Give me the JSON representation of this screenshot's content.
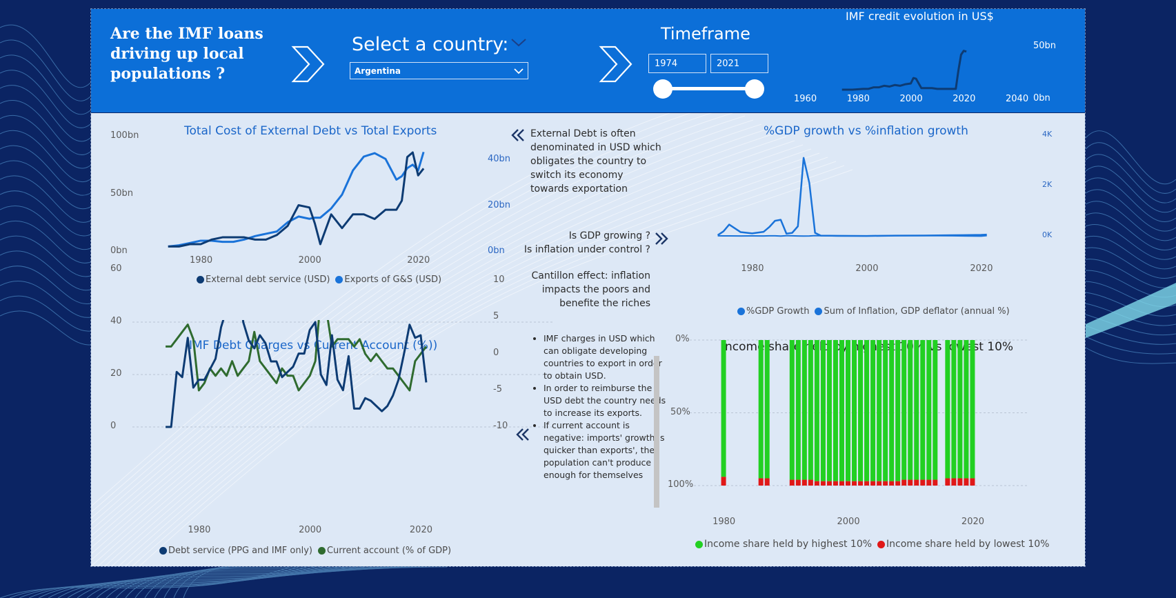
{
  "header": {
    "question": "Are the IMF loans driving up local populations ?",
    "select_label": "Select a country:",
    "country_value": "Argentina",
    "timeframe_label": "Timeframe",
    "timeframe_start": "1974",
    "timeframe_end": "2021"
  },
  "mini_chart": {
    "title": "IMF credit evolution in US$",
    "y_ticks": [
      "50bn",
      "0bn"
    ],
    "x_ticks": [
      "1960",
      "1980",
      "2000",
      "2020",
      "2040"
    ],
    "chart_data": {
      "type": "line",
      "title": "IMF credit evolution in US$",
      "x": [
        1974,
        1978,
        1982,
        1984,
        1986,
        1988,
        1990,
        1992,
        1994,
        1996,
        1998,
        2000,
        2001,
        2002,
        2004,
        2006,
        2008,
        2010,
        2012,
        2014,
        2016,
        2017,
        2018,
        2019,
        2020,
        2021
      ],
      "values": [
        0,
        0,
        1,
        1,
        3,
        3,
        5,
        4,
        6,
        5,
        7,
        8,
        15,
        14,
        2,
        2,
        2,
        1,
        1,
        1,
        1,
        1,
        25,
        45,
        50,
        49
      ],
      "xlim": [
        1960,
        2040
      ],
      "ylim": [
        0,
        55
      ],
      "ylabel": "",
      "color": "#0d3b73"
    }
  },
  "chart1": {
    "title": "Total Cost of External Debt vs Total Exports",
    "left_ticks": [
      "100bn",
      "50bn",
      "0bn"
    ],
    "right_ticks": [
      "40bn",
      "20bn",
      "0bn"
    ],
    "x_ticks": [
      "1980",
      "2000",
      "2020"
    ],
    "legend": [
      "External debt service (USD)",
      "Exports of G&S (USD)"
    ],
    "colors": [
      "#0d3b73",
      "#1a73d9"
    ],
    "chart_data": {
      "type": "line",
      "title": "Total Cost of External Debt vs Total Exports",
      "x": [
        1974,
        1976,
        1978,
        1980,
        1982,
        1984,
        1986,
        1988,
        1990,
        1992,
        1994,
        1996,
        1998,
        2000,
        2001,
        2002,
        2004,
        2006,
        2008,
        2010,
        2012,
        2014,
        2016,
        2017,
        2018,
        2019,
        2020,
        2021
      ],
      "series": [
        {
          "name": "External debt service (USD)",
          "axis": "right",
          "values": [
            2,
            2,
            3,
            3,
            5,
            6,
            6,
            6,
            5,
            5,
            7,
            11,
            20,
            19,
            12,
            3,
            16,
            10,
            16,
            16,
            14,
            18,
            18,
            22,
            41,
            43,
            33,
            36
          ]
        },
        {
          "name": "Exports of G&S (USD)",
          "axis": "left",
          "values": [
            4,
            5,
            7,
            9,
            9,
            8,
            8,
            10,
            13,
            15,
            17,
            25,
            30,
            28,
            29,
            29,
            37,
            49,
            70,
            82,
            85,
            80,
            62,
            65,
            72,
            75,
            70,
            86
          ]
        }
      ],
      "left_ylim": [
        0,
        100
      ],
      "right_ylim": [
        0,
        40
      ],
      "xlim": [
        1972,
        2022
      ]
    }
  },
  "notes": {
    "external_debt": "External Debt is often denominated in USD which obligates the country to switch its economy towards exportation",
    "gdp_q1": "Is GDP growing ?",
    "gdp_q2": "Is inflation under control ?",
    "cantillon": "Cantillon effect: inflation impacts the poors and benefite the riches",
    "bullets": [
      "IMF charges in USD which can obligate developing countries to export in order to obtain USD.",
      "In order to reimburse the USD debt the country needs to increase its exports.",
      "If current account is negative: imports' growth is quicker than exports', the population can't produce enough for themselves anymore."
    ]
  },
  "chart2": {
    "title": "%GDP growth vs %inflation growth",
    "right_ticks": [
      "4K",
      "2K",
      "0K"
    ],
    "x_ticks": [
      "1980",
      "2000",
      "2020"
    ],
    "legend": [
      "%GDP Growth",
      "Sum of Inflation, GDP deflator (annual %)"
    ],
    "colors": [
      "#1a73d9",
      "#1a73d9"
    ],
    "chart_data": {
      "type": "line",
      "title": "%GDP growth vs %inflation growth",
      "x": [
        1974,
        1975,
        1976,
        1978,
        1980,
        1982,
        1983,
        1984,
        1985,
        1986,
        1987,
        1988,
        1989,
        1990,
        1991,
        1992,
        1995,
        2000,
        2005,
        2010,
        2015,
        2020,
        2021
      ],
      "series": [
        {
          "name": "%GDP Growth",
          "values": [
            5,
            -1,
            0,
            -3,
            1,
            -5,
            4,
            2,
            -7,
            7,
            3,
            -2,
            -7,
            -2,
            9,
            8,
            -3,
            -1,
            9,
            10,
            3,
            -10,
            10
          ]
        },
        {
          "name": "Sum of Inflation, GDP deflator (annual %)",
          "values": [
            30,
            180,
            450,
            150,
            100,
            160,
            350,
            600,
            640,
            90,
            120,
            380,
            3100,
            2100,
            120,
            10,
            3,
            -2,
            9,
            15,
            27,
            40,
            50
          ]
        }
      ],
      "ylim": [
        0,
        4000
      ],
      "xlim": [
        1972,
        2022
      ]
    }
  },
  "chart3": {
    "title": "IMF Debt Charges vs Current Account (%))",
    "left_ticks": [
      "60",
      "40",
      "20",
      "0"
    ],
    "right_ticks": [
      "10",
      "5",
      "0",
      "-5",
      "-10"
    ],
    "x_ticks": [
      "1980",
      "2000",
      "2020"
    ],
    "legend": [
      "Debt service (PPG and IMF only)",
      "Current account (% of GDP)"
    ],
    "colors": [
      "#0d3b73",
      "#2f6b2f"
    ],
    "chart_data": {
      "type": "line",
      "title": "IMF Debt Charges vs Current Account (%))",
      "x": [
        1974,
        1975,
        1976,
        1977,
        1978,
        1979,
        1980,
        1981,
        1982,
        1983,
        1984,
        1985,
        1986,
        1987,
        1988,
        1989,
        1990,
        1991,
        1992,
        1993,
        1994,
        1995,
        1996,
        1997,
        1998,
        1999,
        2000,
        2001,
        2002,
        2003,
        2004,
        2005,
        2006,
        2007,
        2008,
        2009,
        2010,
        2011,
        2012,
        2013,
        2014,
        2015,
        2016,
        2017,
        2018,
        2019,
        2020,
        2021
      ],
      "series": [
        {
          "name": "Debt service (PPG and IMF only)",
          "axis": "left",
          "values": [
            0,
            0,
            21,
            19,
            34,
            15,
            18,
            18,
            22,
            26,
            38,
            45,
            67,
            66,
            40,
            33,
            30,
            35,
            32,
            25,
            25,
            19,
            21,
            23,
            28,
            28,
            37,
            40,
            20,
            16,
            35,
            18,
            14,
            27,
            7,
            7,
            11,
            10,
            8,
            6,
            8,
            12,
            18,
            28,
            39,
            34,
            35,
            17,
            12
          ]
        },
        {
          "name": "Current account (% of GDP)",
          "axis": "right",
          "values": [
            1,
            1,
            2,
            3,
            4,
            2,
            -5,
            -4,
            -2,
            -3,
            -2,
            -3,
            -1,
            -3,
            -2,
            -1,
            3,
            -1,
            -2,
            -3,
            -4,
            -2,
            -3,
            -3,
            -5,
            -4,
            -3,
            -1,
            8,
            6,
            1,
            2,
            2,
            2,
            1,
            2,
            0,
            -1,
            0,
            -1,
            -2,
            -2,
            -3,
            -4,
            -5,
            -1,
            0,
            1
          ]
        }
      ],
      "left_ylim": [
        0,
        70
      ],
      "right_ylim": [
        -10,
        10
      ],
      "xlim": [
        1972,
        2022
      ]
    }
  },
  "chart4": {
    "title": "Income share held by highest 10% vs lowest 10%",
    "y_ticks": [
      "0%",
      "50%",
      "100%"
    ],
    "x_ticks": [
      "1980",
      "2000",
      "2020"
    ],
    "legend": [
      "Income share held by highest 10%",
      "Income share held by lowest 10%"
    ],
    "colors": [
      "#22d022",
      "#e01818"
    ],
    "chart_data": {
      "type": "bar",
      "title": "Income share held by highest 10% vs lowest 10%",
      "categories": [
        1980,
        1986,
        1987,
        1991,
        1992,
        1993,
        1994,
        1995,
        1996,
        1997,
        1998,
        1999,
        2000,
        2001,
        2002,
        2003,
        2004,
        2005,
        2006,
        2007,
        2008,
        2009,
        2010,
        2011,
        2012,
        2013,
        2014,
        2016,
        2017,
        2018,
        2019,
        2020
      ],
      "series": [
        {
          "name": "Income share held by highest 10%",
          "values": [
            94,
            95,
            95,
            96,
            96,
            96,
            96,
            97,
            97,
            97,
            97,
            97,
            97,
            97,
            97,
            97,
            97,
            97,
            97,
            97,
            97,
            96,
            96,
            96,
            96,
            96,
            96,
            95,
            95,
            95,
            95,
            95
          ]
        },
        {
          "name": "Income share held by lowest 10%",
          "values": [
            6,
            5,
            5,
            4,
            4,
            4,
            4,
            3,
            3,
            3,
            3,
            3,
            3,
            3,
            3,
            3,
            3,
            3,
            3,
            3,
            3,
            4,
            4,
            4,
            4,
            4,
            4,
            5,
            5,
            5,
            5,
            5
          ]
        }
      ],
      "ylim": [
        0,
        100
      ],
      "xlim": [
        1977,
        2023
      ]
    }
  }
}
